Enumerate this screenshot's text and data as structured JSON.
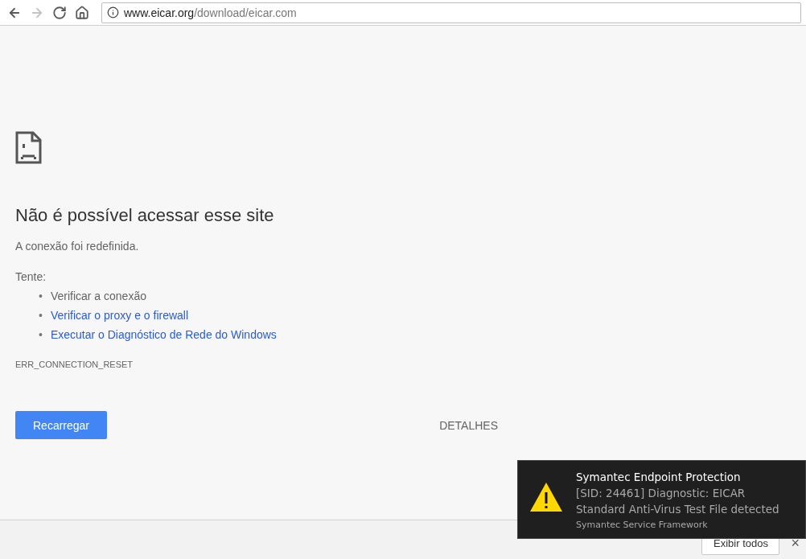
{
  "toolbar": {
    "buttons": [
      {
        "kind": "back",
        "disabled": false
      },
      {
        "kind": "forward",
        "disabled": true
      },
      {
        "kind": "reload",
        "disabled": false
      },
      {
        "kind": "home",
        "disabled": false
      }
    ],
    "address": {
      "host": "www.eicar.org",
      "path": "/download/eicar.com"
    }
  },
  "error_page": {
    "heading": "Não é possível acessar esse site",
    "message": "A conexão foi redefinida.",
    "try_label": "Tente:",
    "suggestions": [
      {
        "kind": "text",
        "bullet": "•",
        "text": "Verificar a conexão"
      },
      {
        "kind": "link",
        "bullet": "•",
        "text": "Verificar o proxy e o firewall"
      },
      {
        "kind": "link",
        "bullet": "•",
        "text": "Executar o Diagnóstico de Rede do Windows"
      }
    ],
    "error_code": "ERR_CONNECTION_RESET",
    "reload_button": "Recarregar",
    "details_button": "DETALHES"
  },
  "download_bar": {
    "show_all_button": "Exibir todos",
    "close": "×"
  },
  "notification": {
    "title": "Symantec Endpoint Protection",
    "body": "[SID: 24461] Diagnostic: EICAR Standard Anti-Virus Test File detected",
    "source": "Symantec Service Framework"
  }
}
